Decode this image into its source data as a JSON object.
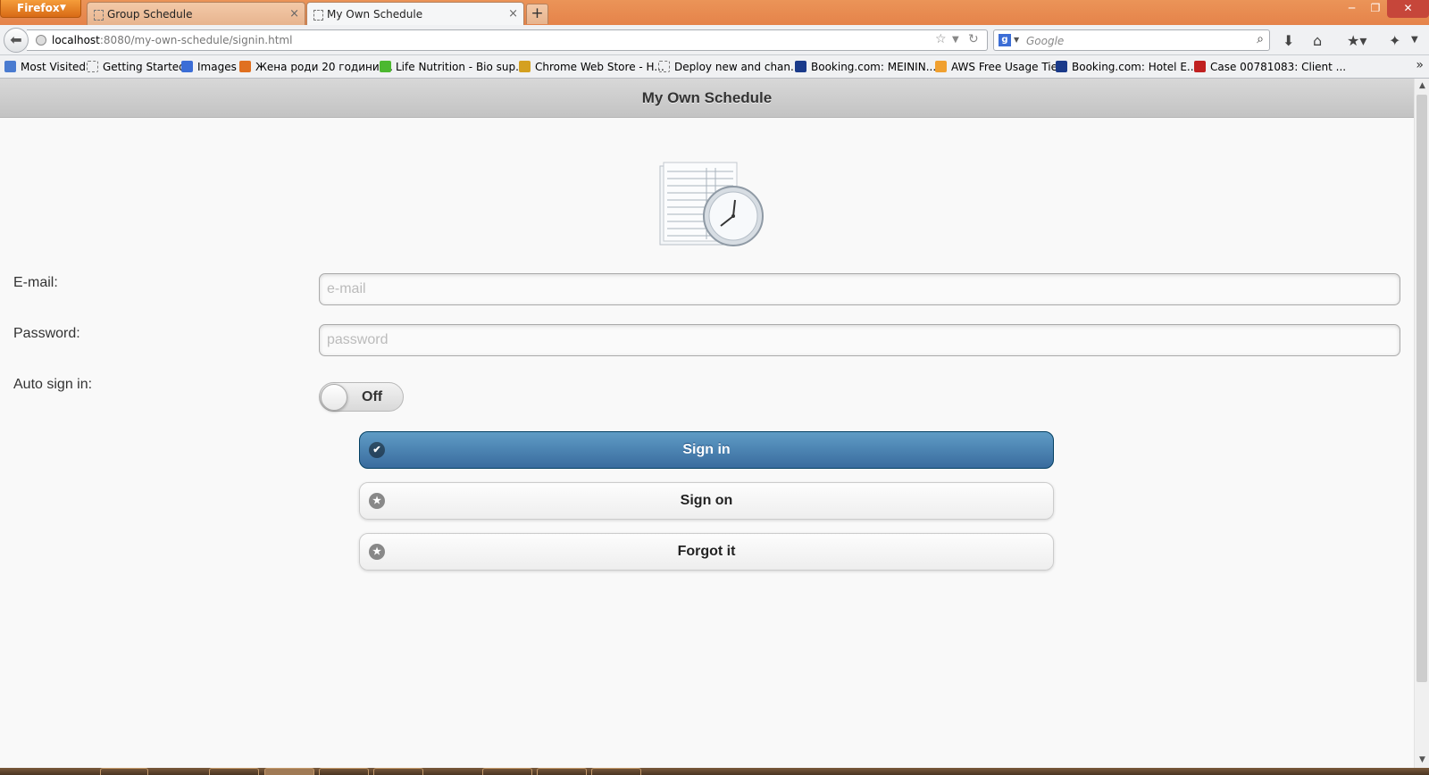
{
  "browser": {
    "menu_button": "Firefox",
    "tabs": [
      {
        "title": "Group Schedule"
      },
      {
        "title": "My Own Schedule"
      }
    ],
    "url_host": "localhost",
    "url_rest": ":8080/my-own-schedule/signin.html",
    "search_placeholder": "Google",
    "search_engine_letter": "g",
    "bookmarks": [
      {
        "label": "Most Visited",
        "icon_color": "#4a7bd0"
      },
      {
        "label": "Getting Started",
        "icon_color": "#ffffff"
      },
      {
        "label": "Images",
        "icon_color": "#3b6dd6"
      },
      {
        "label": "Жена роди 20 години ...",
        "icon_color": "#e07020"
      },
      {
        "label": "Life Nutrition - Bio sup...",
        "icon_color": "#4cb830"
      },
      {
        "label": "Chrome Web Store - H...",
        "icon_color": "#d4a020"
      },
      {
        "label": "Deploy new and chan...",
        "icon_color": "#ffffff"
      },
      {
        "label": "Booking.com: MEININ...",
        "icon_color": "#1a3a8a"
      },
      {
        "label": "AWS Free Usage Tier",
        "icon_color": "#f0a030"
      },
      {
        "label": "Booking.com: Hotel E...",
        "icon_color": "#1a3a8a"
      },
      {
        "label": "Case 00781083: Client ...",
        "icon_color": "#c02020"
      }
    ]
  },
  "page": {
    "title": "My Own Schedule",
    "form": {
      "email_label": "E-mail:",
      "email_placeholder": "e-mail",
      "password_label": "Password:",
      "password_placeholder": "password",
      "auto_signin_label": "Auto sign in:",
      "auto_signin_state": "Off"
    },
    "buttons": {
      "sign_in": "Sign in",
      "sign_on": "Sign on",
      "forgot": "Forgot it"
    }
  },
  "colors": {
    "primary_button": "#396b9e",
    "titlebar": "#e9843f"
  }
}
